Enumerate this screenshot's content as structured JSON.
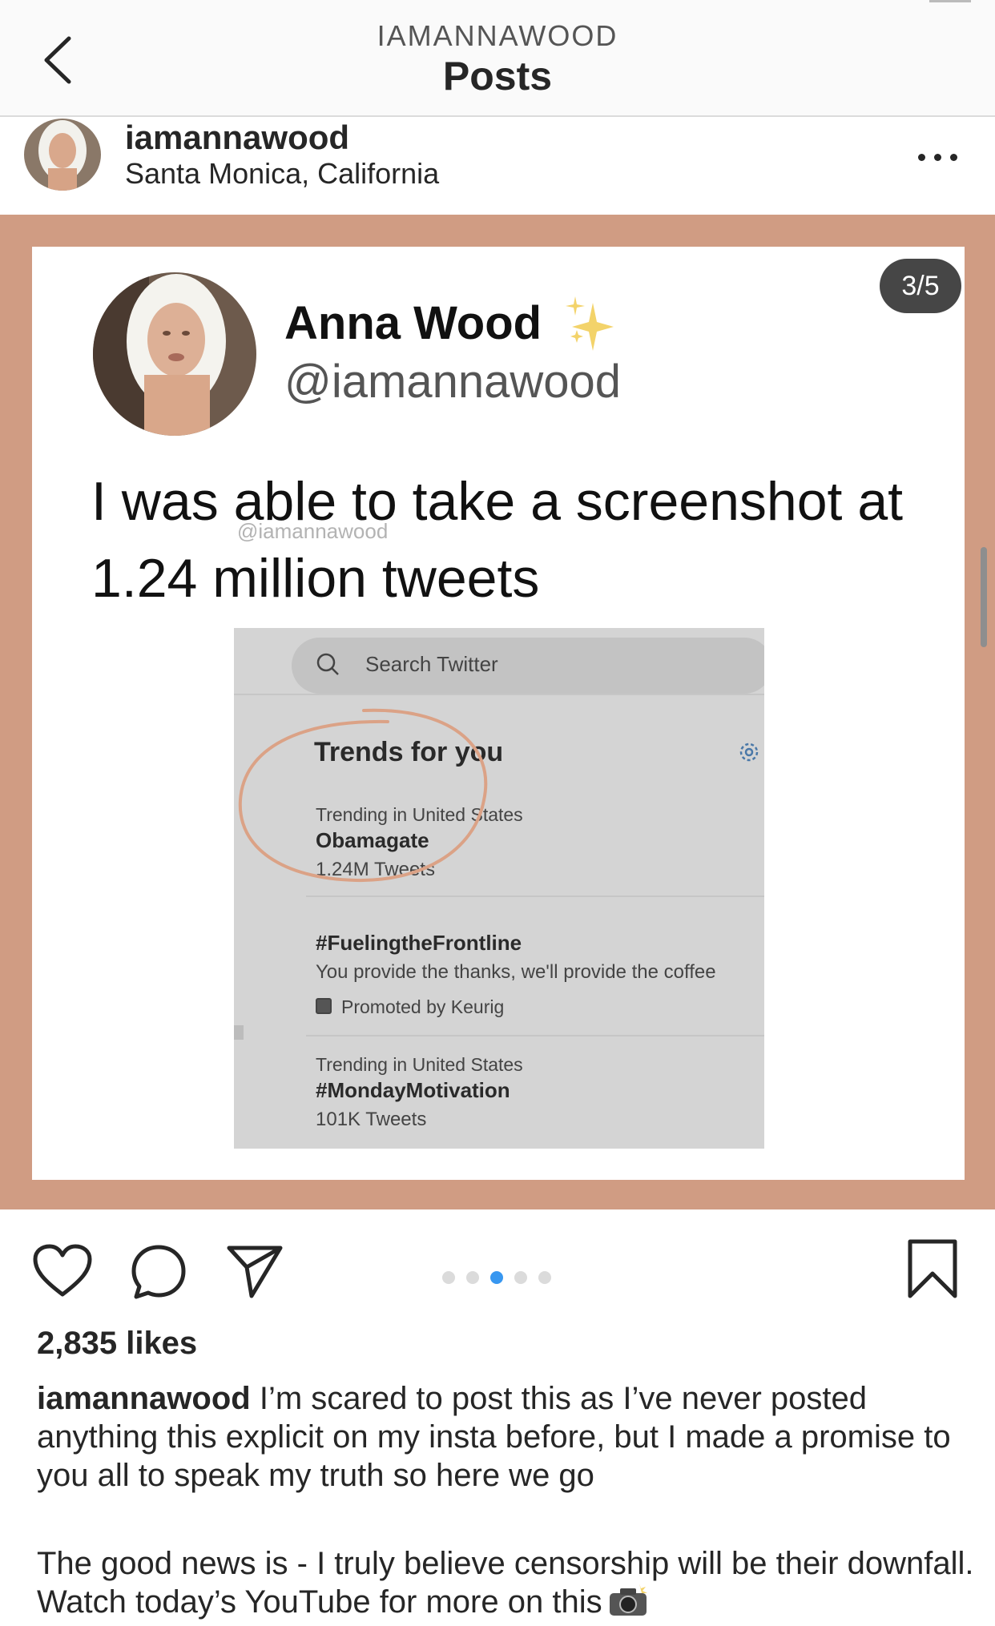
{
  "header": {
    "account": "IAMANNAWOOD",
    "title": "Posts"
  },
  "post": {
    "username": "iamannawood",
    "location": "Santa Monica, California",
    "carousel_counter": "3/5",
    "carousel": {
      "total": 5,
      "active_index": 2
    }
  },
  "tweet": {
    "name": "Anna Wood",
    "handle": "@iamannawood",
    "text": "I was able to take a screenshot at 1.24 million tweets",
    "watermark": "@iamannawood"
  },
  "screenshot": {
    "search_placeholder": "Search Twitter",
    "trends_title": "Trends for you",
    "items": [
      {
        "context": "Trending in United States",
        "title": "Obamagate",
        "count": "1.24M Tweets"
      },
      {
        "title": "#FuelingtheFrontline",
        "desc": "You provide the thanks, we'll provide the coffee",
        "promo": "Promoted by Keurig"
      },
      {
        "context": "Trending in United States",
        "title": "#MondayMotivation",
        "count": "101K Tweets"
      }
    ],
    "highlight_color": "#dba286"
  },
  "engagement": {
    "likes": "2,835 likes",
    "caption_user": "iamannawood",
    "caption_text": "I’m scared to post this as I’ve never posted anything this explicit on my insta before, but I made a promise to you all to speak my truth so here we go",
    "caption_text_2": "The good news is - I truly believe censorship will be their downfall. Watch today’s YouTube for more on this"
  },
  "colors": {
    "frame": "#d09c83",
    "active_dot": "#3897f0"
  }
}
